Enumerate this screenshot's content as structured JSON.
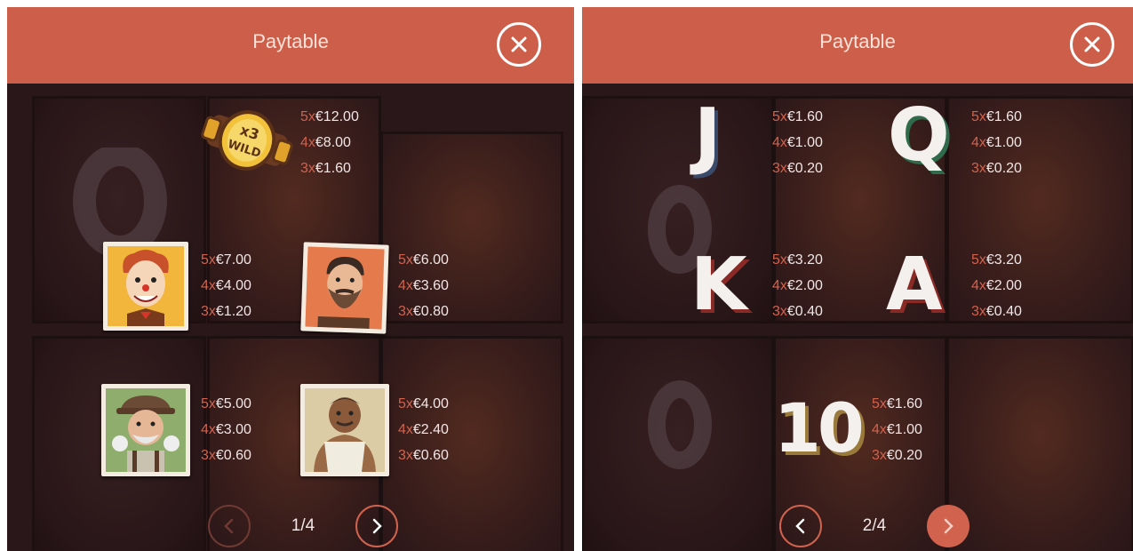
{
  "panels": [
    {
      "title": "Paytable",
      "page": "1/4",
      "symbols": [
        {
          "name": "wild",
          "badge_top": "x3",
          "badge_bottom": "WILD",
          "pays": [
            {
              "mult": "5x",
              "amount": "€12.00"
            },
            {
              "mult": "4x",
              "amount": "€8.00"
            },
            {
              "mult": "3x",
              "amount": "€1.60"
            }
          ]
        },
        {
          "name": "clown",
          "pays": [
            {
              "mult": "5x",
              "amount": "€7.00"
            },
            {
              "mult": "4x",
              "amount": "€4.00"
            },
            {
              "mult": "3x",
              "amount": "€1.20"
            }
          ]
        },
        {
          "name": "bearded-man",
          "pays": [
            {
              "mult": "5x",
              "amount": "€6.00"
            },
            {
              "mult": "4x",
              "amount": "€3.60"
            },
            {
              "mult": "3x",
              "amount": "€0.80"
            }
          ]
        },
        {
          "name": "old-man",
          "pays": [
            {
              "mult": "5x",
              "amount": "€5.00"
            },
            {
              "mult": "4x",
              "amount": "€3.00"
            },
            {
              "mult": "3x",
              "amount": "€0.60"
            }
          ]
        },
        {
          "name": "strongman",
          "pays": [
            {
              "mult": "5x",
              "amount": "€4.00"
            },
            {
              "mult": "4x",
              "amount": "€2.40"
            },
            {
              "mult": "3x",
              "amount": "€0.60"
            }
          ]
        }
      ]
    },
    {
      "title": "Paytable",
      "page": "2/4",
      "symbols": [
        {
          "name": "J",
          "pays": [
            {
              "mult": "5x",
              "amount": "€1.60"
            },
            {
              "mult": "4x",
              "amount": "€1.00"
            },
            {
              "mult": "3x",
              "amount": "€0.20"
            }
          ]
        },
        {
          "name": "Q",
          "pays": [
            {
              "mult": "5x",
              "amount": "€1.60"
            },
            {
              "mult": "4x",
              "amount": "€1.00"
            },
            {
              "mult": "3x",
              "amount": "€0.20"
            }
          ]
        },
        {
          "name": "K",
          "pays": [
            {
              "mult": "5x",
              "amount": "€3.20"
            },
            {
              "mult": "4x",
              "amount": "€2.00"
            },
            {
              "mult": "3x",
              "amount": "€0.40"
            }
          ]
        },
        {
          "name": "A",
          "pays": [
            {
              "mult": "5x",
              "amount": "€3.20"
            },
            {
              "mult": "4x",
              "amount": "€2.00"
            },
            {
              "mult": "3x",
              "amount": "€0.40"
            }
          ]
        },
        {
          "name": "10",
          "pays": [
            {
              "mult": "5x",
              "amount": "€1.60"
            },
            {
              "mult": "4x",
              "amount": "€1.00"
            },
            {
              "mult": "3x",
              "amount": "€0.20"
            }
          ]
        }
      ]
    }
  ],
  "colors": {
    "header": "#cd5f4a",
    "accent": "#d0624e",
    "background": "#2a1719"
  },
  "icons": {
    "close": "close-icon",
    "prev": "chevron-left-icon",
    "next": "chevron-right-icon"
  }
}
